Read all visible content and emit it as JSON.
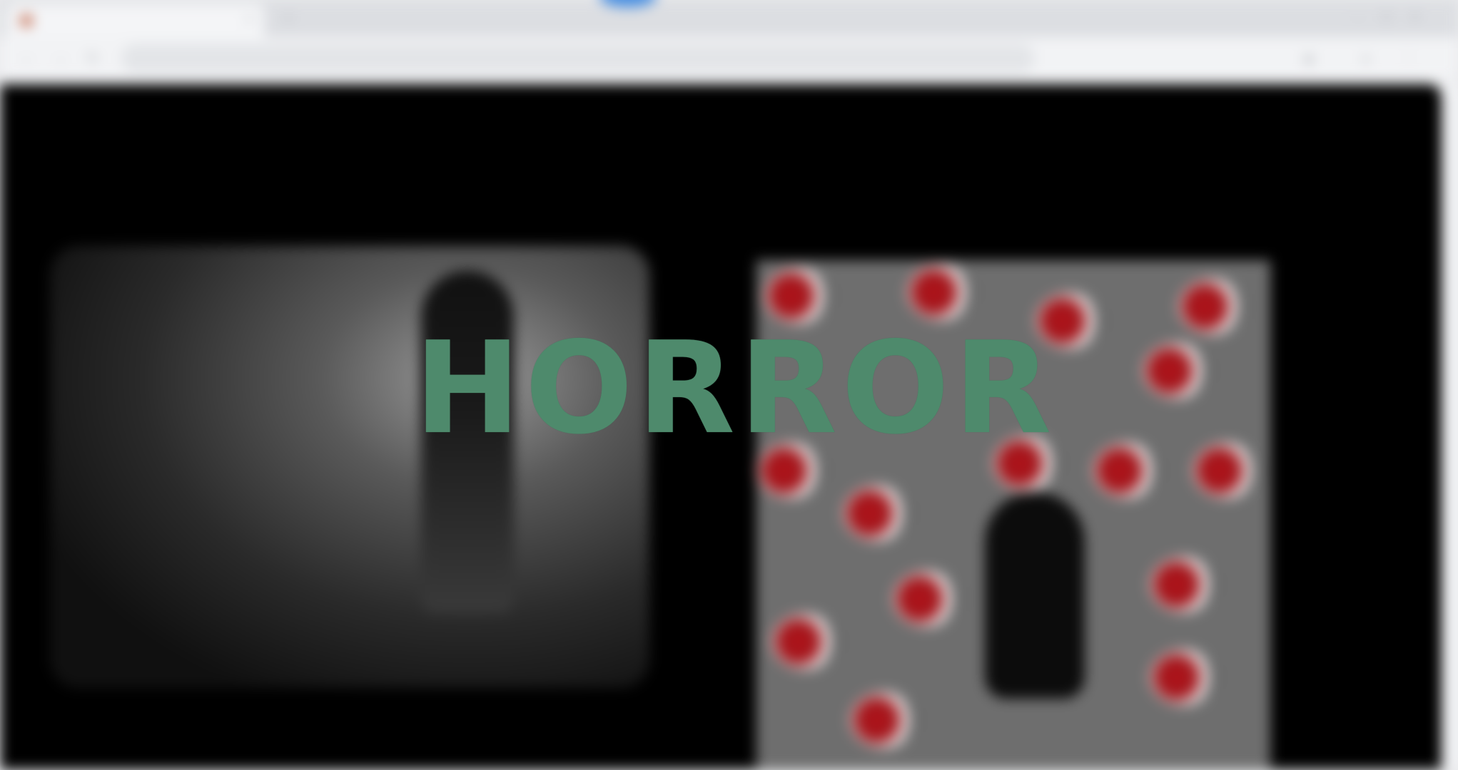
{
  "overlay": {
    "word": "HORROR",
    "color": "#4e8a6c"
  },
  "browser": {
    "tab_title": "",
    "address": "",
    "icons": {
      "back": "back-arrow-icon",
      "forward": "forward-arrow-icon",
      "reload": "reload-icon",
      "new_tab": "plus-icon",
      "minimize": "minimize-icon",
      "maximize": "maximize-icon",
      "close": "close-icon"
    }
  },
  "page": {
    "left_title": "",
    "left_subtitle": "",
    "right_title": "",
    "right_subtitle": "",
    "left_caption": ""
  }
}
